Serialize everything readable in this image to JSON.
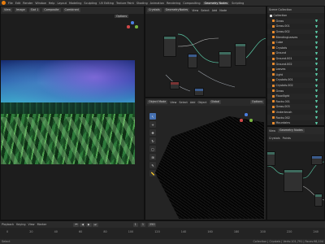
{
  "topbar": {
    "menus": [
      "File",
      "Edit",
      "Render",
      "Window",
      "Help"
    ],
    "tabs": [
      "Layout",
      "Modeling",
      "Sculpting",
      "UV Editing",
      "Texture Paint",
      "Shading",
      "Animation",
      "Rendering",
      "Compositing",
      "Geometry Nodes",
      "Scripting"
    ],
    "active_tab": "Geometry Nodes",
    "scene": "Scene",
    "view_layer": "ViewLayer"
  },
  "image_editor": {
    "view_label": "View",
    "image_label": "Image",
    "slot": "Slot 1",
    "layer": "Composite",
    "pass": "Combined",
    "options": "Options"
  },
  "node_editor": {
    "object": "Crystals",
    "modifier": "GeometryNodes",
    "menus": [
      "View",
      "Select",
      "Add",
      "Node"
    ]
  },
  "outliner": {
    "root": "Scene Collection",
    "collection": "Collection",
    "items": [
      "Grass",
      "Grass.001",
      "Grass.002",
      "BlendingLeaves",
      "Cube",
      "Crystals",
      "Ground",
      "Ground.001",
      "Ground.002",
      "Leaves",
      "Light",
      "Crystals.001",
      "Crystals.002",
      "Grass",
      "Floodlight",
      "Rocks.001",
      "Grass.003",
      "Underbrush",
      "Rocks.002",
      "Mountains",
      "Sun"
    ]
  },
  "viewport": {
    "mode": "Object Mode",
    "menus": [
      "View",
      "Select",
      "Add",
      "Object"
    ],
    "transform": "Global",
    "options": "Options"
  },
  "props_editor": {
    "tabs": [
      "View",
      "Geometry Nodes"
    ],
    "object": "Crystals",
    "mod": "Points"
  },
  "timeline": {
    "labels": [
      "Playback",
      "Keying",
      "View",
      "Marker"
    ],
    "ticks": [
      "0",
      "20",
      "40",
      "60",
      "80",
      "100",
      "120",
      "140",
      "160",
      "180",
      "200",
      "220",
      "240"
    ],
    "current_frame": "1",
    "start": "1",
    "end": "250"
  },
  "status": {
    "left": "Select",
    "right": "Collection | Crystals | Verts:101,791 | Faces:98,104"
  },
  "colors": {
    "accent": "#e87d0d",
    "blue": "#4772b3",
    "teal": "#3e6b5e"
  }
}
